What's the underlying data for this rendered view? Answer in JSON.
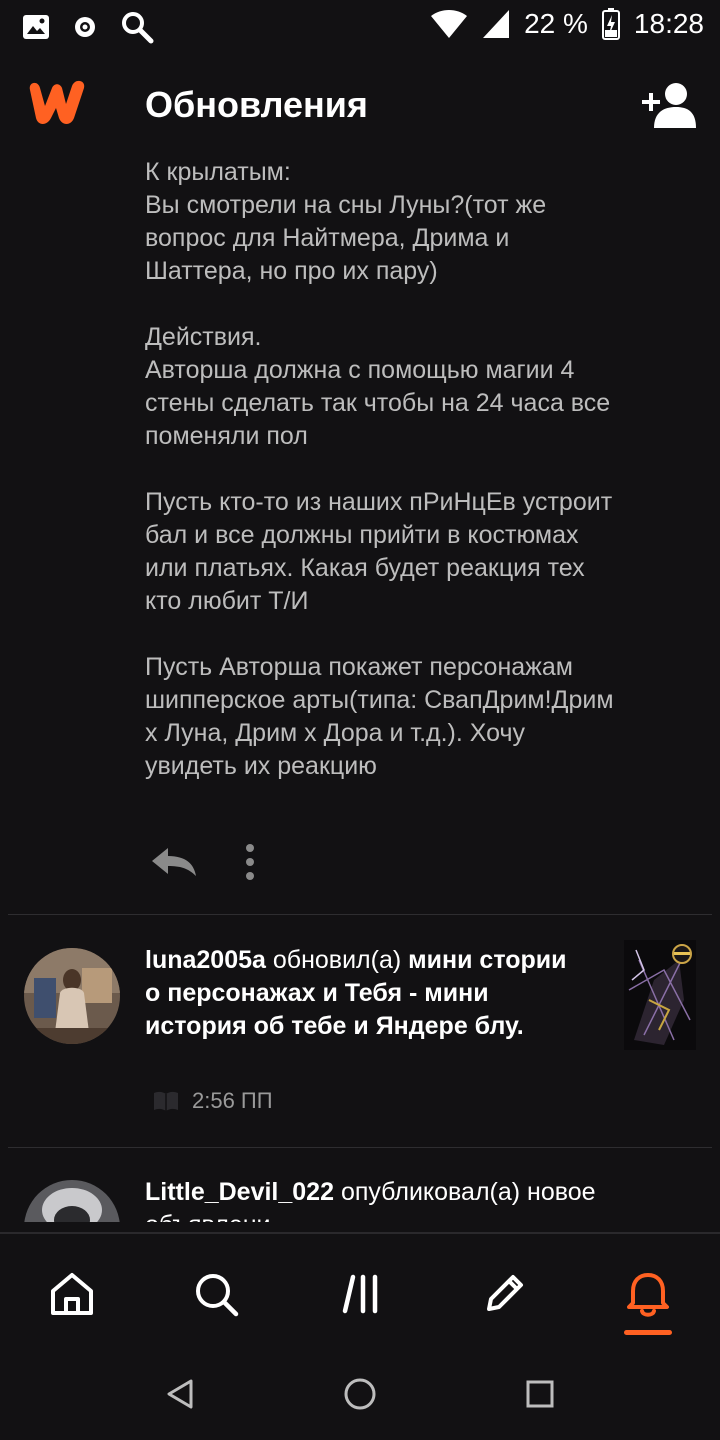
{
  "status_bar": {
    "battery": "22 %",
    "time": "18:28"
  },
  "header": {
    "title": "Обновления"
  },
  "message": {
    "text": "К крылатым:\nВы смотрели на сны Луны?(тот же вопрос для Найтмера, Дрима и Шаттера, но про их пару)\n\nДействия.\nАвторша должна с помощью магии 4 стены сделать так чтобы на 24 часа все поменяли пол\n\nПусть кто-то из наших пРиНцЕв устроит бал и все должны прийти в костюмах или платьях. Какая будет реакция тех кто любит Т/И\n\nПусть Авторша покажет персонажам шипперское арты(типа: СвапДрим!Дрим х Луна, Дрим х Дора и т.д.). Хочу увидеть их реакцию"
  },
  "updates": [
    {
      "username": "luna2005a",
      "action": " обновил(а) ",
      "story": "мини стории о персонажах и Тебя - мини история об тебе и Яндере блу.",
      "time": "2:56 ПП"
    },
    {
      "username": "Little_Devil_022",
      "action": " опубликовал(а) новое объявлени"
    }
  ],
  "colors": {
    "accent": "#ff6122",
    "background": "#121113",
    "body_text": "#bdbdbd"
  },
  "nav": {
    "items": [
      "home-icon",
      "search-icon",
      "library-icon",
      "write-icon",
      "notifications-icon"
    ],
    "active": "notifications-icon"
  }
}
